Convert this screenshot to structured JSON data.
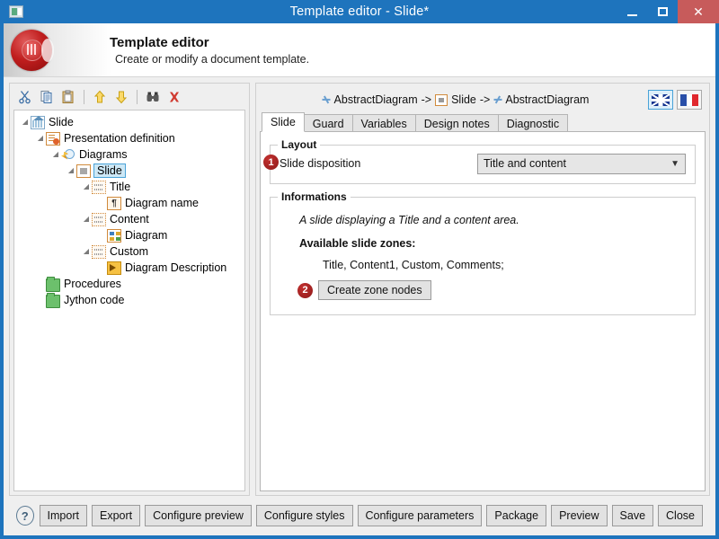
{
  "window": {
    "title": "Template editor - Slide*",
    "icon": "app-icon",
    "minimize_label": "–",
    "maximize_label": "□",
    "close_label": "✕"
  },
  "banner": {
    "title": "Template editor",
    "subtitle": "Create or modify a document template.",
    "logo": "red-disc-logo"
  },
  "tree_toolbar": {
    "items": [
      {
        "name": "cut-icon",
        "glyph": "✂"
      },
      {
        "name": "copy-icon",
        "glyph": "⎘"
      },
      {
        "name": "paste-icon",
        "glyph": "ὌB"
      },
      {
        "name": "move-up-icon",
        "glyph": "⇧"
      },
      {
        "name": "move-down-icon",
        "glyph": "⇩"
      },
      {
        "name": "find-icon",
        "glyph": "ὐD"
      },
      {
        "name": "delete-icon",
        "glyph": "✖"
      }
    ]
  },
  "tree": {
    "nodes": [
      {
        "label": "Slide",
        "depth": 0,
        "icon": "house-icon",
        "twist": "collapse",
        "selected": false
      },
      {
        "label": "Presentation definition",
        "depth": 1,
        "icon": "presentation-icon",
        "twist": "collapse",
        "selected": false
      },
      {
        "label": "Diagrams",
        "depth": 2,
        "icon": "magic-wand-icon",
        "twist": "collapse",
        "selected": false
      },
      {
        "label": "Slide",
        "depth": 3,
        "icon": "slide-icon",
        "twist": "collapse",
        "selected": true
      },
      {
        "label": "Title",
        "depth": 4,
        "icon": "zone-icon",
        "twist": "collapse",
        "selected": false
      },
      {
        "label": "Diagram name",
        "depth": 5,
        "icon": "paragraph-icon",
        "twist": "none",
        "selected": false
      },
      {
        "label": "Content",
        "depth": 4,
        "icon": "zone-icon",
        "twist": "collapse",
        "selected": false
      },
      {
        "label": "Diagram",
        "depth": 5,
        "icon": "diagram-icon",
        "twist": "none",
        "selected": false
      },
      {
        "label": "Custom",
        "depth": 4,
        "icon": "zone-icon",
        "twist": "collapse",
        "selected": false
      },
      {
        "label": "Diagram Description",
        "depth": 5,
        "icon": "description-icon",
        "twist": "none",
        "selected": false
      },
      {
        "label": "Procedures",
        "depth": 1,
        "icon": "folder-icon",
        "twist": "none",
        "selected": false
      },
      {
        "label": "Jython code",
        "depth": 1,
        "icon": "folder-icon",
        "twist": "none",
        "selected": false
      }
    ]
  },
  "breadcrumb": {
    "part1": "AbstractDiagram",
    "arrow1": "->",
    "part2": "Slide",
    "arrow2": "->",
    "part3": "AbstractDiagram"
  },
  "language_buttons": [
    {
      "name": "flag-uk-button",
      "label": "English",
      "selected": true
    },
    {
      "name": "flag-fr-button",
      "label": "French",
      "selected": false
    }
  ],
  "tabs": [
    {
      "label": "Slide",
      "active": true
    },
    {
      "label": "Guard",
      "active": false
    },
    {
      "label": "Variables",
      "active": false
    },
    {
      "label": "Design notes",
      "active": false
    },
    {
      "label": "Diagnostic",
      "active": false
    }
  ],
  "layout_group": {
    "title": "Layout",
    "badge": "1",
    "field_label": "Slide disposition",
    "combo_value": "Title and content",
    "combo_caret": "⌄"
  },
  "informations_group": {
    "title": "Informations",
    "description": "A slide displaying a Title and a content area.",
    "zones_heading": "Available slide zones:",
    "zones_value": "Title, Content1, Custom, Comments;",
    "badge": "2",
    "button_label": "Create zone nodes"
  },
  "footer": {
    "help_label": "?",
    "buttons": [
      "Import",
      "Export",
      "Configure preview",
      "Configure styles",
      "Configure parameters",
      "Package",
      "Preview",
      "Save",
      "Close"
    ]
  },
  "colors": {
    "window_frame": "#1e74bd",
    "close_button": "#c75b5b",
    "selection": "#cde8f6",
    "badge_red": "#a52424",
    "accent_orange": "#d08a3c"
  }
}
